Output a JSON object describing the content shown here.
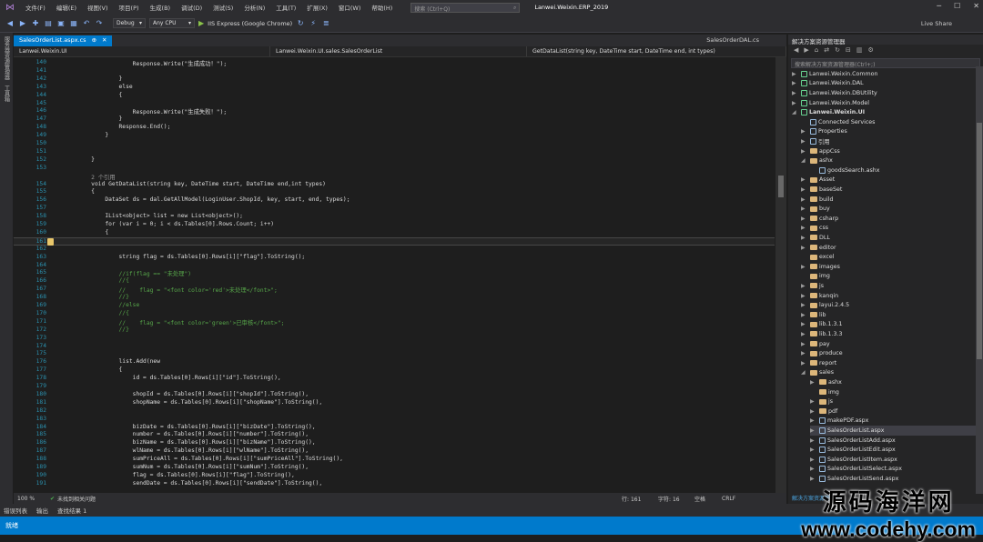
{
  "titlebar": {
    "menus": [
      "文件(F)",
      "编辑(E)",
      "视图(V)",
      "项目(P)",
      "生成(B)",
      "调试(D)",
      "测试(S)",
      "分析(N)",
      "工具(T)",
      "扩展(X)",
      "窗口(W)",
      "帮助(H)"
    ],
    "search_placeholder": "搜索 (Ctrl+Q)",
    "solution_name": "Lanwei.Weixin.ERP_2019"
  },
  "toolbar": {
    "config": "Debug",
    "platform": "Any CPU",
    "run_target": "IIS Express (Google Chrome)",
    "live_share": "Live Share"
  },
  "left_rail": [
    "服务器资源管理器",
    "工具箱"
  ],
  "editor": {
    "tab_label": "SalesOrderList.aspx.cs",
    "right_tab_label": "SalesOrderDAL.cs",
    "nav": [
      "Lanwei.Weixin.UI",
      "Lanwei.Weixin.UI.sales.SalesOrderList",
      "GetDataList(string key, DateTime start, DateTime end, int types)"
    ],
    "lines": [
      [
        "140",
        "                Response.Write(\"生成成功！\");"
      ],
      [
        "141",
        ""
      ],
      [
        "142",
        "            }"
      ],
      [
        "143",
        "            else"
      ],
      [
        "144",
        "            {"
      ],
      [
        "145",
        ""
      ],
      [
        "146",
        "                Response.Write(\"生成失败！\");"
      ],
      [
        "147",
        "            }"
      ],
      [
        "148",
        "            Response.End();"
      ],
      [
        "149",
        "        }"
      ],
      [
        "150",
        ""
      ],
      [
        "151",
        ""
      ],
      [
        "152",
        "    }"
      ],
      [
        "153",
        ""
      ],
      [
        "",
        "    2 个引用"
      ],
      [
        "154",
        "    void GetDataList(string key, DateTime start, DateTime end,int types)"
      ],
      [
        "155",
        "    {"
      ],
      [
        "156",
        "        DataSet ds = dal.GetAllModel(LoginUser.ShopId, key, start, end, types);"
      ],
      [
        "157",
        ""
      ],
      [
        "158",
        "        IList<object> list = new List<object>();"
      ],
      [
        "159",
        "        for (var i = 0; i < ds.Tables[0].Rows.Count; i++)"
      ],
      [
        "160",
        "        {"
      ],
      [
        "161",
        ""
      ],
      [
        "162",
        ""
      ],
      [
        "163",
        "            string flag = ds.Tables[0].Rows[i][\"flag\"].ToString();"
      ],
      [
        "164",
        ""
      ],
      [
        "165",
        "            //if(flag == \"未处理\")"
      ],
      [
        "166",
        "            //{"
      ],
      [
        "167",
        "            //    flag = \"<font color='red'>未处理</font>\";"
      ],
      [
        "168",
        "            //}"
      ],
      [
        "169",
        "            //else"
      ],
      [
        "170",
        "            //{"
      ],
      [
        "171",
        "            //    flag = \"<font color='green'>已审核</font>\";"
      ],
      [
        "172",
        "            //}"
      ],
      [
        "173",
        ""
      ],
      [
        "174",
        ""
      ],
      [
        "175",
        ""
      ],
      [
        "176",
        "            list.Add(new"
      ],
      [
        "177",
        "            {"
      ],
      [
        "178",
        "                id = ds.Tables[0].Rows[i][\"id\"].ToString(),"
      ],
      [
        "179",
        ""
      ],
      [
        "180",
        "                shopId = ds.Tables[0].Rows[i][\"shopId\"].ToString(),"
      ],
      [
        "181",
        "                shopName = ds.Tables[0].Rows[i][\"shopName\"].ToString(),"
      ],
      [
        "182",
        ""
      ],
      [
        "183",
        ""
      ],
      [
        "184",
        "                bizDate = ds.Tables[0].Rows[i][\"bizDate\"].ToString(),"
      ],
      [
        "185",
        "                number = ds.Tables[0].Rows[i][\"number\"].ToString(),"
      ],
      [
        "186",
        "                bizName = ds.Tables[0].Rows[i][\"bizName\"].ToString(),"
      ],
      [
        "187",
        "                wlName = ds.Tables[0].Rows[i][\"wlName\"].ToString(),"
      ],
      [
        "188",
        "                sumPriceAll = ds.Tables[0].Rows[i][\"sumPriceAll\"].ToString(),"
      ],
      [
        "189",
        "                sumNum = ds.Tables[0].Rows[i][\"sumNum\"].ToString(),"
      ],
      [
        "190",
        "                flag = ds.Tables[0].Rows[i][\"flag\"].ToString(),"
      ],
      [
        "191",
        "                sendDate = ds.Tables[0].Rows[i][\"sendDate\"].ToString(),"
      ]
    ],
    "status": {
      "zoom": "100 %",
      "issues": "未找到相关问题",
      "line": "行: 161",
      "col": "字符: 16",
      "mode": "空格",
      "eol": "CRLF"
    }
  },
  "solution_explorer": {
    "title": "解决方案资源管理器",
    "search_placeholder": "搜索解决方案资源管理器(Ctrl+;)",
    "footer": "解决方案资源管理器",
    "items": [
      {
        "label": "Lanwei.Weixin.Common",
        "depth": 0,
        "kind": "project",
        "expanded": false
      },
      {
        "label": "Lanwei.Weixin.DAL",
        "depth": 0,
        "kind": "project",
        "expanded": false
      },
      {
        "label": "Lanwei.Weixin.DBUtility",
        "depth": 0,
        "kind": "project",
        "expanded": false
      },
      {
        "label": "Lanwei.Weixin.Model",
        "depth": 0,
        "kind": "project",
        "expanded": false
      },
      {
        "label": "Lanwei.Weixin.UI",
        "depth": 0,
        "kind": "project",
        "expanded": true
      },
      {
        "label": "Connected Services",
        "depth": 1,
        "kind": "file",
        "expanded": null
      },
      {
        "label": "Properties",
        "depth": 1,
        "kind": "file",
        "expanded": false
      },
      {
        "label": "引用",
        "depth": 1,
        "kind": "file",
        "expanded": false
      },
      {
        "label": "appCss",
        "depth": 1,
        "kind": "folder",
        "expanded": false
      },
      {
        "label": "ashx",
        "depth": 1,
        "kind": "folder",
        "expanded": true
      },
      {
        "label": "goodsSearch.ashx",
        "depth": 2,
        "kind": "file",
        "expanded": null
      },
      {
        "label": "Asset",
        "depth": 1,
        "kind": "folder",
        "expanded": false
      },
      {
        "label": "baseSet",
        "depth": 1,
        "kind": "folder",
        "expanded": false
      },
      {
        "label": "build",
        "depth": 1,
        "kind": "folder",
        "expanded": false
      },
      {
        "label": "buy",
        "depth": 1,
        "kind": "folder",
        "expanded": false
      },
      {
        "label": "csharp",
        "depth": 1,
        "kind": "folder",
        "expanded": false
      },
      {
        "label": "css",
        "depth": 1,
        "kind": "folder",
        "expanded": false
      },
      {
        "label": "DLL",
        "depth": 1,
        "kind": "folder",
        "expanded": false
      },
      {
        "label": "editor",
        "depth": 1,
        "kind": "folder",
        "expanded": false
      },
      {
        "label": "excel",
        "depth": 1,
        "kind": "folder",
        "expanded": null
      },
      {
        "label": "images",
        "depth": 1,
        "kind": "folder",
        "expanded": false
      },
      {
        "label": "img",
        "depth": 1,
        "kind": "folder",
        "expanded": null
      },
      {
        "label": "js",
        "depth": 1,
        "kind": "folder",
        "expanded": false
      },
      {
        "label": "kanqin",
        "depth": 1,
        "kind": "folder",
        "expanded": false
      },
      {
        "label": "layui.2.4.5",
        "depth": 1,
        "kind": "folder",
        "expanded": false
      },
      {
        "label": "lib",
        "depth": 1,
        "kind": "folder",
        "expanded": false
      },
      {
        "label": "lib.1.3.1",
        "depth": 1,
        "kind": "folder",
        "expanded": false
      },
      {
        "label": "lib.1.3.3",
        "depth": 1,
        "kind": "folder",
        "expanded": false
      },
      {
        "label": "pay",
        "depth": 1,
        "kind": "folder",
        "expanded": false
      },
      {
        "label": "produce",
        "depth": 1,
        "kind": "folder",
        "expanded": false
      },
      {
        "label": "report",
        "depth": 1,
        "kind": "folder",
        "expanded": false
      },
      {
        "label": "sales",
        "depth": 1,
        "kind": "folder",
        "expanded": true
      },
      {
        "label": "ashx",
        "depth": 2,
        "kind": "folder",
        "expanded": false
      },
      {
        "label": "img",
        "depth": 2,
        "kind": "folder",
        "expanded": null
      },
      {
        "label": "js",
        "depth": 2,
        "kind": "folder",
        "expanded": false
      },
      {
        "label": "pdf",
        "depth": 2,
        "kind": "folder",
        "expanded": false
      },
      {
        "label": "makePDF.aspx",
        "depth": 2,
        "kind": "file",
        "expanded": false
      },
      {
        "label": "SalesOrderList.aspx",
        "depth": 2,
        "kind": "file",
        "expanded": false
      },
      {
        "label": "SalesOrderListAdd.aspx",
        "depth": 2,
        "kind": "file",
        "expanded": false
      },
      {
        "label": "SalesOrderListEdit.aspx",
        "depth": 2,
        "kind": "file",
        "expanded": false
      },
      {
        "label": "SalesOrderListItem.aspx",
        "depth": 2,
        "kind": "file",
        "expanded": false
      },
      {
        "label": "SalesOrderListSelect.aspx",
        "depth": 2,
        "kind": "file",
        "expanded": false
      },
      {
        "label": "SalesOrderListSend.aspx",
        "depth": 2,
        "kind": "file",
        "expanded": false
      }
    ]
  },
  "bottom_tabs": [
    "错误列表",
    "输出",
    "查找结果 1"
  ],
  "statusbar": {
    "text": "就绪"
  },
  "watermark": {
    "line1": "源码海洋网",
    "line2": "www.codehy.com"
  }
}
